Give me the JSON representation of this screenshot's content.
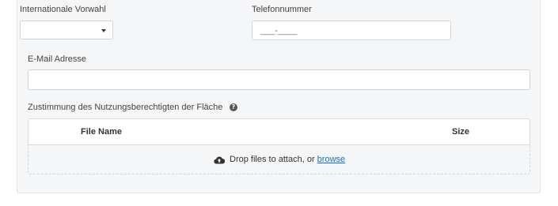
{
  "form": {
    "country_code": {
      "label": "Internationale Vorwahl",
      "selected": ""
    },
    "phone": {
      "label": "Telefonnummer",
      "placeholder": "___-____",
      "value": ""
    },
    "email": {
      "label": "E-Mail Adresse",
      "value": ""
    },
    "consent": {
      "label": "Zustimmung des Nutzungsberechtigten der Fläche",
      "help_icon": "question-circle-icon",
      "table": {
        "columns": [
          "File Name",
          "Size"
        ]
      },
      "drop_zone": {
        "icon": "cloud-upload-icon",
        "text": "Drop files to attach, or ",
        "link_label": "browse"
      }
    }
  },
  "colors": {
    "panel_background": "#f5f6f8",
    "link": "#1a6fc9"
  }
}
